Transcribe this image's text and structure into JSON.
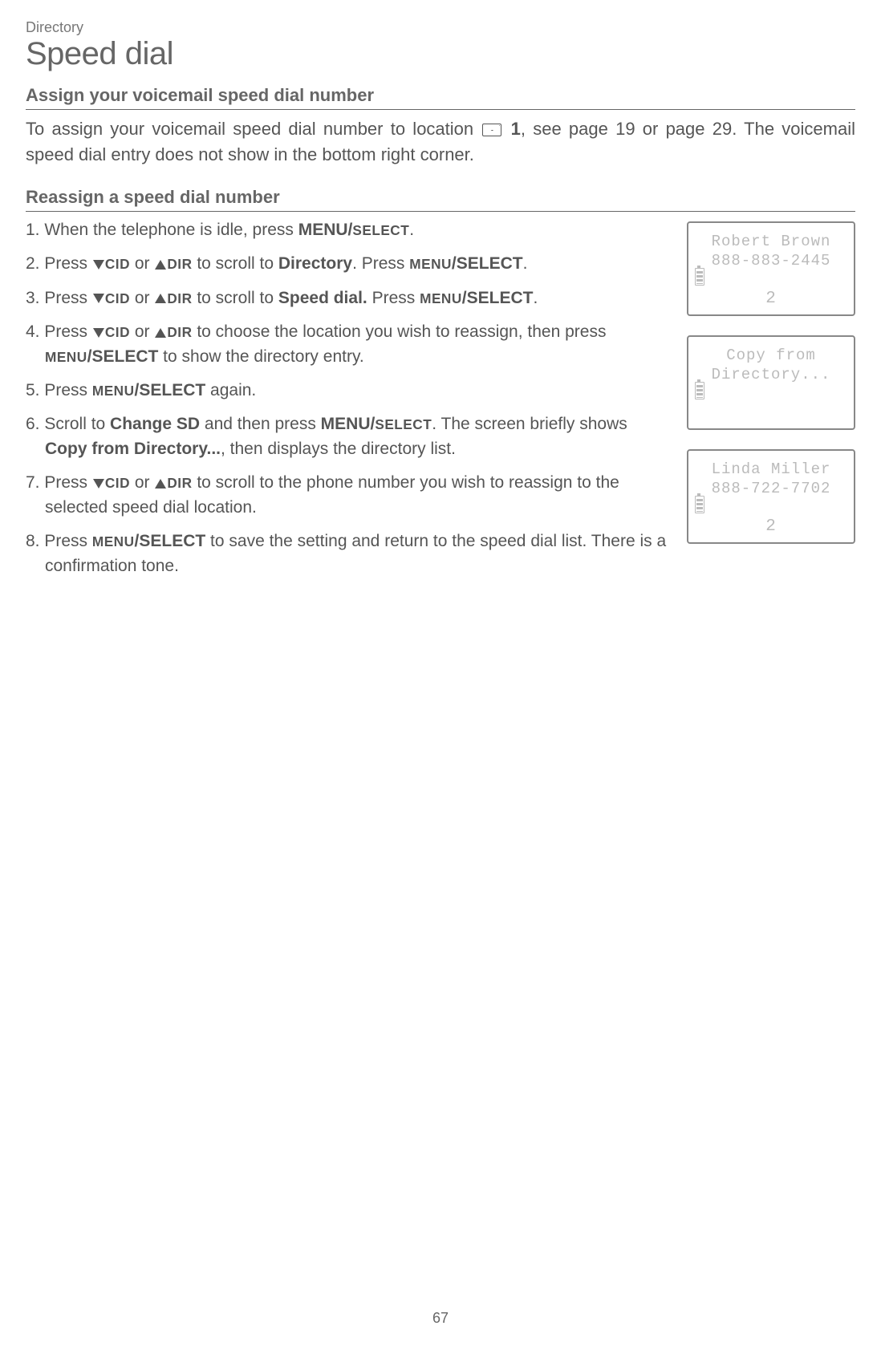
{
  "breadcrumb": "Directory",
  "title": "Speed dial",
  "section1": {
    "heading": "Assign your voicemail speed dial number",
    "intro_pre": "To assign your voicemail speed dial number to location ",
    "intro_loc": "1",
    "intro_post": ", see page 19 or page 29. The voicemail speed dial entry does not show in the bottom right corner."
  },
  "section2": {
    "heading": "Reassign a speed dial number"
  },
  "steps": {
    "s1_a": "1. When the telephone is idle, press ",
    "s1_b": "MENU/",
    "s1_c": "SELECT",
    "s1_d": ".",
    "s2_a": "2. Press ",
    "s2_cid": "CID",
    "s2_or": " or ",
    "s2_dir": "DIR",
    "s2_mid": " to scroll to ",
    "s2_dir_label": "Directory",
    "s2_press": ". Press ",
    "s2_menu": "MENU",
    "s2_select": "/SELECT",
    "s2_end": ".",
    "s3_a": "3. Press ",
    "s3_mid": " to scroll to ",
    "s3_sd": "Speed dial.",
    "s3_press": " Press ",
    "s3_menu": "MENU",
    "s3_select": "/SELECT",
    "s3_end": ".",
    "s4_a": "4. Press ",
    "s4_mid": " to choose the location you wish to reassign, then press ",
    "s4_menu": "MENU",
    "s4_select": "/SELECT",
    "s4_end": " to show the directory entry.",
    "s5_a": "5. Press ",
    "s5_menu": "MENU",
    "s5_select": "/SELECT",
    "s5_end": " again.",
    "s6_a": "6. Scroll to ",
    "s6_csd": "Change SD",
    "s6_mid": " and then press ",
    "s6_menu": "MENU/",
    "s6_select": "SELECT",
    "s6_mid2": ". The screen briefly shows ",
    "s6_copy": "Copy from Directory...",
    "s6_end": ", then displays the directory list.",
    "s7_a": "7. Press ",
    "s7_mid": " to scroll to the phone number you wish to reassign to the selected speed dial location.",
    "s8_a": "8. Press ",
    "s8_menu": "MENU",
    "s8_select": "/SELECT",
    "s8_end": " to save the setting and return to the speed dial list. There is a confirmation tone."
  },
  "screens": [
    {
      "line1": "Robert Brown",
      "line2": "888-883-2445",
      "slot": "2"
    },
    {
      "line1": "Copy from",
      "line2": "Directory...",
      "slot": ""
    },
    {
      "line1": "Linda Miller",
      "line2": "888-722-7702",
      "slot": "2"
    }
  ],
  "page_number": "67"
}
